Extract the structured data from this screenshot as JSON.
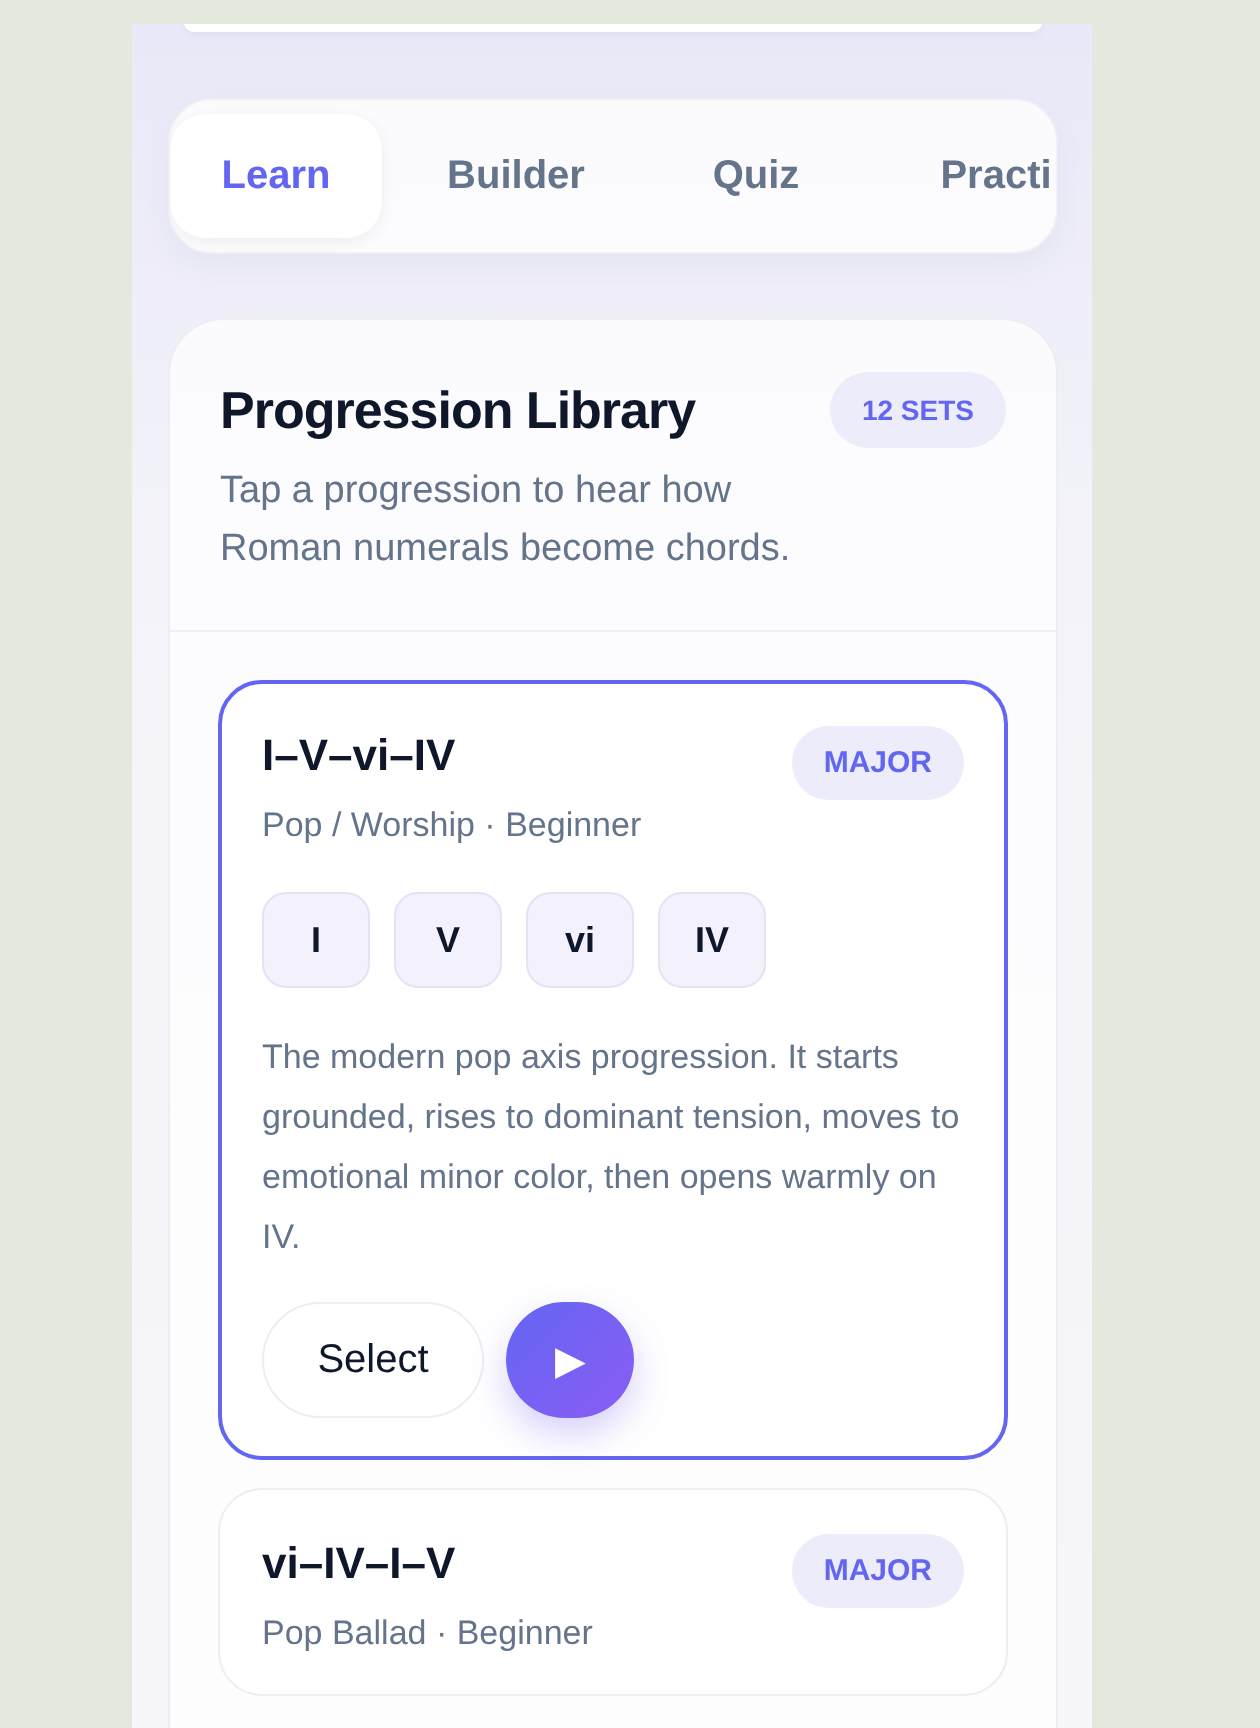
{
  "tabs": [
    {
      "label": "Learn",
      "selected": true
    },
    {
      "label": "Builder",
      "selected": false
    },
    {
      "label": "Quiz",
      "selected": false
    },
    {
      "label": "Practi",
      "selected": false
    }
  ],
  "library": {
    "title": "Progression Library",
    "badge": "12 SETS",
    "subtitle": "Tap a progression to hear how Roman numerals become chords.",
    "progressions": [
      {
        "title": "I–V–vi–IV",
        "mode": "MAJOR",
        "meta": "Pop / Worship · Beginner",
        "selected": true,
        "chords": [
          "I",
          "V",
          "vi",
          "IV"
        ],
        "description": "The modern pop axis progression. It starts grounded, rises to dominant tension, moves to emotional minor color, then opens warmly on IV.",
        "select_label": "Select",
        "play_icon": "▶"
      },
      {
        "title": "vi–IV–I–V",
        "mode": "MAJOR",
        "meta": "Pop Ballad · Beginner",
        "selected": false
      }
    ]
  }
}
